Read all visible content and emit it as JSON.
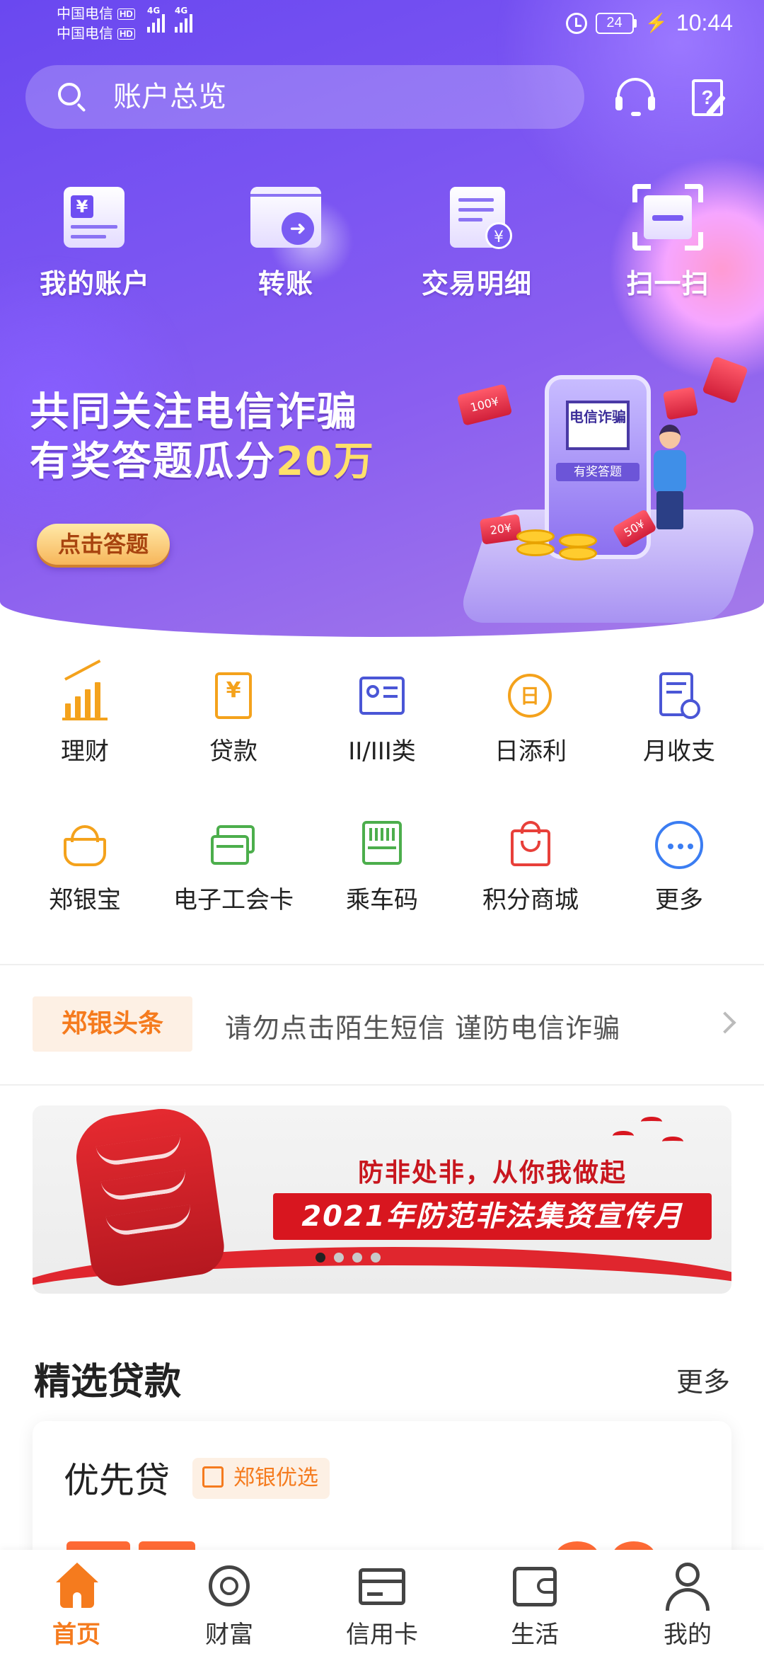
{
  "status_bar": {
    "carrier_1": "中国电信",
    "carrier_2": "中国电信",
    "hd": "HD",
    "network": "4G",
    "battery": "24",
    "time": "10:44"
  },
  "header": {
    "search_placeholder": "账户总览",
    "icons": [
      "search-icon",
      "headset-icon",
      "help-doc-icon"
    ]
  },
  "quick_actions": [
    {
      "label": "我的账户",
      "icon": "account-card-icon"
    },
    {
      "label": "转账",
      "icon": "transfer-icon"
    },
    {
      "label": "交易明细",
      "icon": "transaction-detail-icon"
    },
    {
      "label": "扫一扫",
      "icon": "scan-icon"
    }
  ],
  "promo": {
    "line1": "共同关注电信诈骗",
    "line2": "有奖答题瓜分",
    "line2_highlight": "20万",
    "button": "点击答题",
    "phone_screen": "电信诈骗",
    "phone_tag": "有奖答题",
    "envelope_1": "100¥",
    "envelope_2": "20¥",
    "envelope_3": "50¥"
  },
  "menu_grid": [
    {
      "label": "理财",
      "icon": "wealth-chart-icon"
    },
    {
      "label": "贷款",
      "icon": "loan-icon"
    },
    {
      "label": "II/III类",
      "icon": "id-card-icon"
    },
    {
      "label": "日添利",
      "icon": "daily-interest-icon"
    },
    {
      "label": "月收支",
      "icon": "monthly-statement-icon"
    },
    {
      "label": "郑银宝",
      "icon": "treasure-basket-icon"
    },
    {
      "label": "电子工会卡",
      "icon": "union-card-icon"
    },
    {
      "label": "乘车码",
      "icon": "transit-code-icon"
    },
    {
      "label": "积分商城",
      "icon": "points-mall-icon"
    },
    {
      "label": "更多",
      "icon": "more-icon"
    }
  ],
  "news": {
    "tag": "郑银头条",
    "text": "请勿点击陌生短信 谨防电信诈骗"
  },
  "carousel": {
    "slogan": "防非处非，从你我做起",
    "campaign": "2021年防范非法集资宣传月",
    "pages": 4,
    "active_page": 1
  },
  "loans": {
    "title": "精选贷款",
    "more": "更多",
    "card": {
      "name": "优先贷",
      "badge": "郑银优选"
    }
  },
  "bottom_nav": [
    {
      "label": "首页",
      "icon": "home-icon",
      "active": true
    },
    {
      "label": "财富",
      "icon": "wealth-icon",
      "active": false
    },
    {
      "label": "信用卡",
      "icon": "credit-card-icon",
      "active": false
    },
    {
      "label": "生活",
      "icon": "wallet-icon",
      "active": false
    },
    {
      "label": "我的",
      "icon": "profile-icon",
      "active": false
    }
  ],
  "colors": {
    "hero_primary": "#6a48f0",
    "accent_orange": "#f57b1e",
    "icon_gold": "#f4a21c",
    "icon_blue": "#3b7df2",
    "icon_green": "#4cae4c",
    "icon_red": "#e8403a",
    "campaign_red": "#d8161f"
  }
}
